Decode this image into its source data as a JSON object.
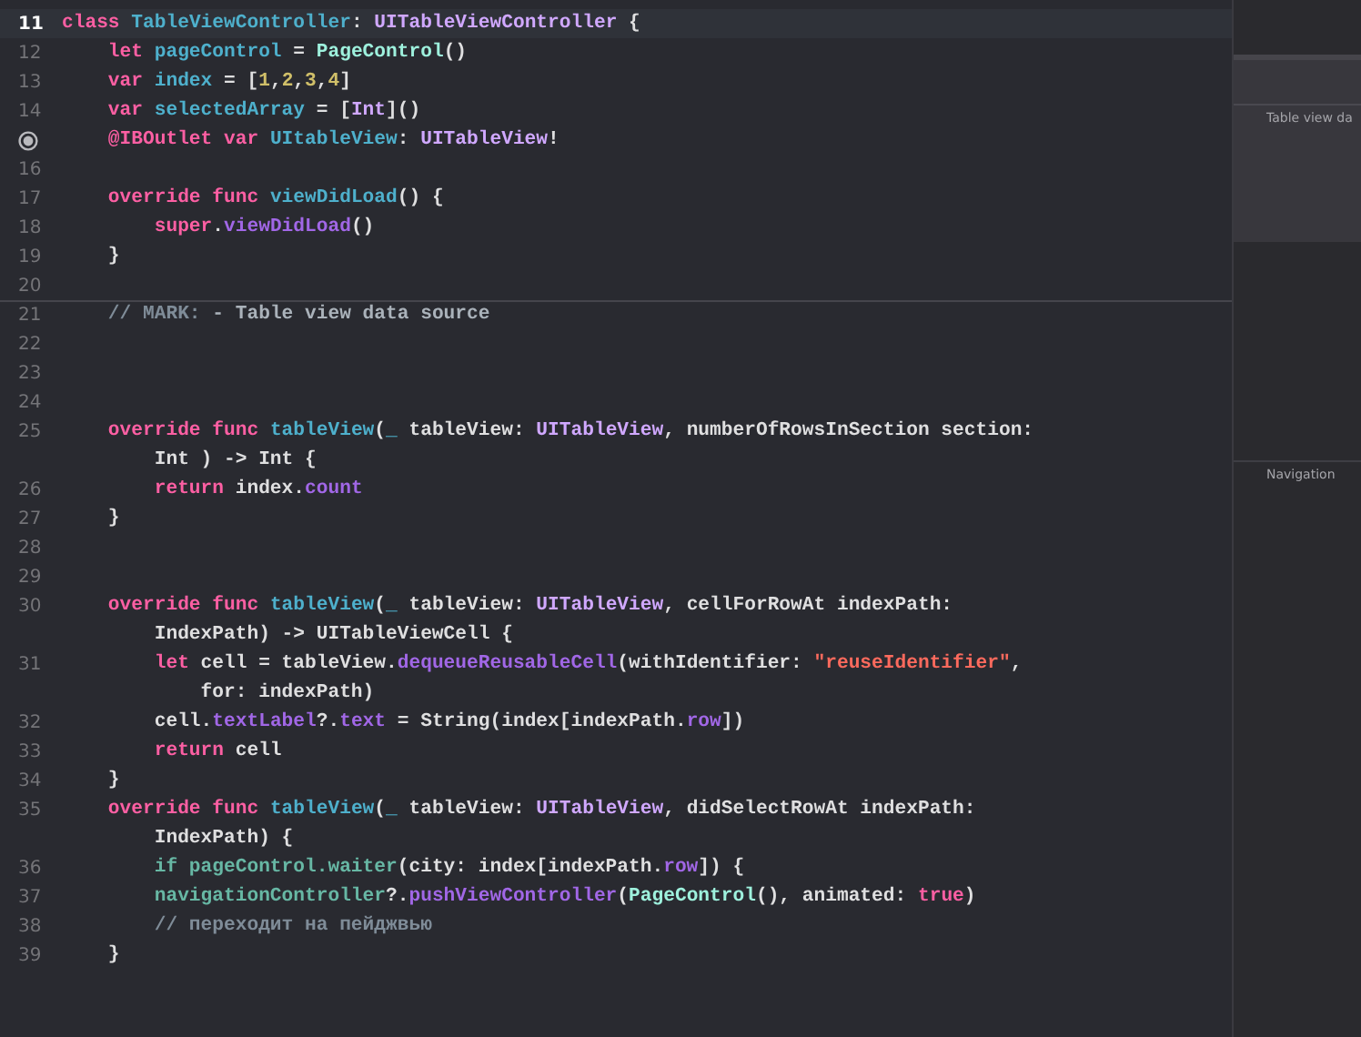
{
  "editor": {
    "lines": [
      {
        "number": "11",
        "kind": "code",
        "current": true,
        "rows": [
          {
            "tokens": [
              {
                "kind": "kw",
                "text": "class "
              },
              {
                "kind": "decl",
                "text": "TableViewController"
              },
              {
                "kind": "p",
                "text": ": "
              },
              {
                "kind": "systype",
                "text": "UITableViewController"
              },
              {
                "kind": "p",
                "text": " {"
              }
            ]
          }
        ]
      },
      {
        "number": "12",
        "kind": "code",
        "current": false,
        "rows": [
          {
            "tokens": [
              {
                "kind": "kw",
                "text": "    let "
              },
              {
                "kind": "decl",
                "text": "pageControl"
              },
              {
                "kind": "p",
                "text": " = "
              },
              {
                "kind": "projtype",
                "text": "PageControl"
              },
              {
                "kind": "p",
                "text": "()"
              }
            ]
          }
        ]
      },
      {
        "number": "13",
        "kind": "code",
        "current": false,
        "rows": [
          {
            "tokens": [
              {
                "kind": "kw",
                "text": "    var "
              },
              {
                "kind": "decl",
                "text": "index"
              },
              {
                "kind": "p",
                "text": " = ["
              },
              {
                "kind": "num",
                "text": "1"
              },
              {
                "kind": "p",
                "text": ","
              },
              {
                "kind": "num",
                "text": "2"
              },
              {
                "kind": "p",
                "text": ","
              },
              {
                "kind": "num",
                "text": "3"
              },
              {
                "kind": "p",
                "text": ","
              },
              {
                "kind": "num",
                "text": "4"
              },
              {
                "kind": "p",
                "text": "]"
              }
            ]
          }
        ]
      },
      {
        "number": "14",
        "kind": "code",
        "current": false,
        "rows": [
          {
            "tokens": [
              {
                "kind": "kw",
                "text": "    var "
              },
              {
                "kind": "decl",
                "text": "selectedArray"
              },
              {
                "kind": "p",
                "text": " = ["
              },
              {
                "kind": "systype",
                "text": "Int"
              },
              {
                "kind": "p",
                "text": "]()"
              }
            ]
          }
        ]
      },
      {
        "kind": "outlet",
        "rows": [
          {
            "tokens": [
              {
                "kind": "kw",
                "text": "    @IBOutlet var "
              },
              {
                "kind": "decl",
                "text": "UItableView"
              },
              {
                "kind": "p",
                "text": ": "
              },
              {
                "kind": "systype",
                "text": "UITableView"
              },
              {
                "kind": "p",
                "text": "!"
              }
            ]
          }
        ]
      },
      {
        "number": "16",
        "kind": "code",
        "current": false
      },
      {
        "number": "17",
        "kind": "code",
        "current": false,
        "rows": [
          {
            "tokens": [
              {
                "kind": "kw",
                "text": "    override func "
              },
              {
                "kind": "decl",
                "text": "viewDidLoad"
              },
              {
                "kind": "p",
                "text": "() {"
              }
            ]
          }
        ]
      },
      {
        "number": "18",
        "kind": "code",
        "current": false,
        "rows": [
          {
            "tokens": [
              {
                "kind": "kw",
                "text": "        super"
              },
              {
                "kind": "p",
                "text": "."
              },
              {
                "kind": "sysfn",
                "text": "viewDidLoad"
              },
              {
                "kind": "p",
                "text": "()"
              }
            ]
          }
        ]
      },
      {
        "number": "19",
        "kind": "code",
        "current": false,
        "rows": [
          {
            "tokens": [
              {
                "kind": "p",
                "text": "    }"
              }
            ]
          }
        ]
      },
      {
        "number": "20",
        "kind": "code",
        "current": false
      },
      {
        "number": "21",
        "kind": "mark",
        "current": false,
        "rows": [
          {
            "tokens": [
              {
                "kind": "cm",
                "text": "    // MARK: "
              },
              {
                "kind": "cmb",
                "text": "- Table view data source"
              }
            ]
          }
        ]
      },
      {
        "number": "22",
        "kind": "code",
        "current": false
      },
      {
        "number": "23",
        "kind": "code",
        "current": false
      },
      {
        "number": "24",
        "kind": "code",
        "current": false
      },
      {
        "number": "25",
        "kind": "code",
        "current": false,
        "rows": [
          {
            "tokens": [
              {
                "kind": "kw",
                "text": "    override func "
              },
              {
                "kind": "decl",
                "text": "tableView"
              },
              {
                "kind": "p",
                "text": "("
              },
              {
                "kind": "decl",
                "text": "_"
              },
              {
                "kind": "p",
                "text": " tableView: "
              },
              {
                "kind": "systype",
                "text": "UITableView"
              },
              {
                "kind": "p",
                "text": ", numberOfRowsInSection section:"
              }
            ]
          },
          {
            "tokens": [
              {
                "kind": "p",
                "text": "        Int ) -> Int {"
              }
            ]
          }
        ]
      },
      {
        "number": "26",
        "kind": "code",
        "current": false,
        "rows": [
          {
            "tokens": [
              {
                "kind": "kw",
                "text": "        return "
              },
              {
                "kind": "p",
                "text": "index."
              },
              {
                "kind": "sysfn",
                "text": "count"
              }
            ]
          }
        ]
      },
      {
        "number": "27",
        "kind": "code",
        "current": false,
        "rows": [
          {
            "tokens": [
              {
                "kind": "p",
                "text": "    }"
              }
            ]
          }
        ]
      },
      {
        "number": "28",
        "kind": "code",
        "current": false
      },
      {
        "number": "29",
        "kind": "code",
        "current": false
      },
      {
        "number": "30",
        "kind": "code",
        "current": false,
        "rows": [
          {
            "tokens": [
              {
                "kind": "kw",
                "text": "    override func "
              },
              {
                "kind": "decl",
                "text": "tableView"
              },
              {
                "kind": "p",
                "text": "("
              },
              {
                "kind": "decl",
                "text": "_"
              },
              {
                "kind": "p",
                "text": " tableView: "
              },
              {
                "kind": "systype",
                "text": "UITableView"
              },
              {
                "kind": "p",
                "text": ", cellForRowAt indexPath:"
              }
            ]
          },
          {
            "tokens": [
              {
                "kind": "p",
                "text": "        IndexPath) -> UITableViewCell {"
              }
            ]
          }
        ]
      },
      {
        "number": "31",
        "kind": "code",
        "current": false,
        "rows": [
          {
            "tokens": [
              {
                "kind": "kw",
                "text": "        let "
              },
              {
                "kind": "p",
                "text": "cell = tableView."
              },
              {
                "kind": "sysfn",
                "text": "dequeueReusableCell"
              },
              {
                "kind": "p",
                "text": "(withIdentifier: "
              },
              {
                "kind": "str",
                "text": "\"reuseIdentifier\""
              },
              {
                "kind": "p",
                "text": ","
              }
            ]
          },
          {
            "tokens": [
              {
                "kind": "p",
                "text": "            for: indexPath)"
              }
            ]
          }
        ]
      },
      {
        "number": "32",
        "kind": "code",
        "current": false,
        "rows": [
          {
            "tokens": [
              {
                "kind": "p",
                "text": "        cell."
              },
              {
                "kind": "sysfn",
                "text": "textLabel"
              },
              {
                "kind": "p",
                "text": "?."
              },
              {
                "kind": "sysfn",
                "text": "text"
              },
              {
                "kind": "p",
                "text": " = String(index[indexPath."
              },
              {
                "kind": "sysfn",
                "text": "row"
              },
              {
                "kind": "p",
                "text": "])"
              }
            ]
          }
        ]
      },
      {
        "number": "33",
        "kind": "code",
        "current": false,
        "rows": [
          {
            "tokens": [
              {
                "kind": "kw",
                "text": "        return "
              },
              {
                "kind": "p",
                "text": "cell"
              }
            ]
          }
        ]
      },
      {
        "number": "34",
        "kind": "code",
        "current": false,
        "rows": [
          {
            "tokens": [
              {
                "kind": "p",
                "text": "    }"
              }
            ]
          }
        ]
      },
      {
        "number": "35",
        "kind": "code",
        "current": false,
        "rows": [
          {
            "tokens": [
              {
                "kind": "kw",
                "text": "    override func "
              },
              {
                "kind": "decl",
                "text": "tableView"
              },
              {
                "kind": "p",
                "text": "("
              },
              {
                "kind": "decl",
                "text": "_"
              },
              {
                "kind": "p",
                "text": " tableView: "
              },
              {
                "kind": "systype",
                "text": "UITableView"
              },
              {
                "kind": "p",
                "text": ", didSelectRowAt indexPath:"
              }
            ]
          },
          {
            "tokens": [
              {
                "kind": "p",
                "text": "        IndexPath) {"
              }
            ]
          }
        ]
      },
      {
        "number": "36",
        "kind": "code",
        "current": false,
        "rows": [
          {
            "tokens": [
              {
                "kind": "proj",
                "text": "        if pageControl.waiter"
              },
              {
                "kind": "p",
                "text": "(city: index[indexPath."
              },
              {
                "kind": "sysfn",
                "text": "row"
              },
              {
                "kind": "p",
                "text": "]) {"
              }
            ]
          }
        ]
      },
      {
        "number": "37",
        "kind": "code",
        "current": false,
        "rows": [
          {
            "tokens": [
              {
                "kind": "proj",
                "text": "        navigationController"
              },
              {
                "kind": "p",
                "text": "?."
              },
              {
                "kind": "sysfn",
                "text": "pushViewController"
              },
              {
                "kind": "p",
                "text": "("
              },
              {
                "kind": "projtype",
                "text": "PageControl"
              },
              {
                "kind": "p",
                "text": "(), animated: "
              },
              {
                "kind": "kw",
                "text": "true"
              },
              {
                "kind": "p",
                "text": ")"
              }
            ]
          }
        ]
      },
      {
        "number": "38",
        "kind": "code",
        "current": false,
        "rows": [
          {
            "tokens": [
              {
                "kind": "cm",
                "text": "        // переходит на пейджвью"
              }
            ]
          }
        ]
      },
      {
        "number": "39",
        "kind": "code",
        "current": false,
        "rows": [
          {
            "tokens": [
              {
                "kind": "p",
                "text": "    }"
              }
            ]
          }
        ]
      }
    ]
  },
  "minimap": {
    "sections": [
      "Table view da",
      "Navigation"
    ]
  }
}
